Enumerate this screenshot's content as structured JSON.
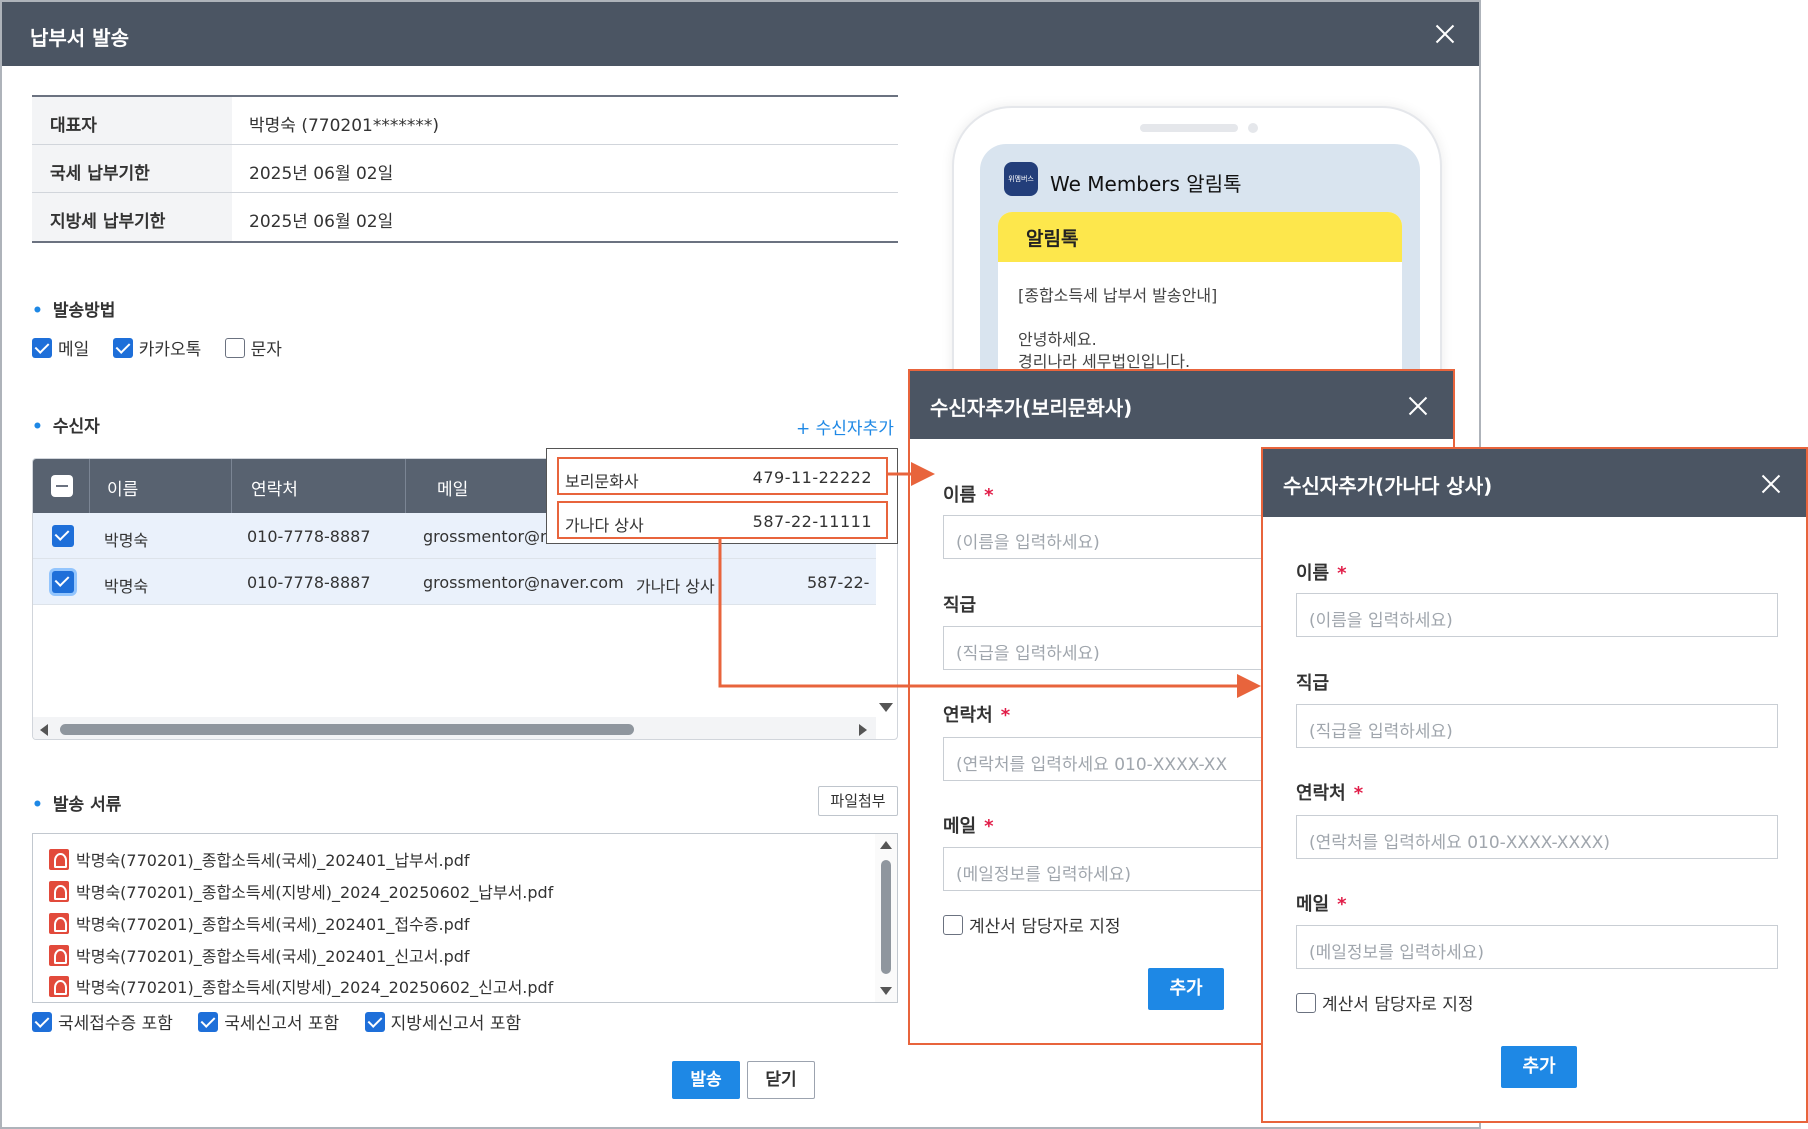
{
  "main": {
    "title": "납부서 발송",
    "info": [
      {
        "label": "대표자",
        "value": "박명숙 (770201*******)"
      },
      {
        "label": "국세 납부기한",
        "value": "2025년 06월 02일"
      },
      {
        "label": "지방세 납부기한",
        "value": "2025년 06월 02일"
      }
    ],
    "method_section": "발송방법",
    "methods": [
      {
        "label": "메일",
        "checked": true
      },
      {
        "label": "카카오톡",
        "checked": true
      },
      {
        "label": "문자",
        "checked": false
      }
    ],
    "recipient_section": "수신자",
    "add_recipient_link": "+ 수신자추가",
    "grid": {
      "headers": [
        "이름",
        "연락처",
        "메일"
      ],
      "rows": [
        {
          "name": "박명숙",
          "phone": "010-7778-8887",
          "email": "grossmentor@n"
        },
        {
          "name": "박명숙",
          "phone": "010-7778-8887",
          "email": "grossmentor@naver.com",
          "company": "가나다 상사",
          "bizno": "587-22-"
        }
      ]
    },
    "docs_section": "발송 서류",
    "attach_button": "파일첨부",
    "files": [
      "박명숙(770201)_종합소득세(국세)_202401_납부서.pdf",
      "박명숙(770201)_종합소득세(지방세)_2024_20250602_납부서.pdf",
      "박명숙(770201)_종합소득세(국세)_202401_접수증.pdf",
      "박명숙(770201)_종합소득세(국세)_202401_신고서.pdf",
      "박명숙(770201)_종합소득세(지방세)_2024_20250602_신고서.pdf"
    ],
    "include_options": [
      {
        "label": "국세접수증 포함",
        "checked": true
      },
      {
        "label": "국세신고서 포함",
        "checked": true
      },
      {
        "label": "지방세신고서 포함",
        "checked": true
      }
    ],
    "send_button": "발송",
    "close_button": "닫기"
  },
  "phone": {
    "logo_text": "위멤버스",
    "sender": "We Members 알림톡",
    "card_header": "알림톡",
    "lines": [
      "[종합소득세 납부서 발송안내]",
      "",
      "안녕하세요.",
      "경리나라 세무법인입니다."
    ]
  },
  "dropdown": {
    "options": [
      {
        "name": "보리문화사",
        "bizno": "479-11-22222"
      },
      {
        "name": "가나다 상사",
        "bizno": "587-22-11111"
      }
    ]
  },
  "dialog1": {
    "title": "수신자추가(보리문화사)",
    "fields": [
      {
        "label": "이름",
        "required": true,
        "placeholder": "(이름을 입력하세요)"
      },
      {
        "label": "직급",
        "required": false,
        "placeholder": "(직급을 입력하세요)"
      },
      {
        "label": "연락처",
        "required": true,
        "placeholder": "(연락처를 입력하세요 010-XXXX-XX"
      },
      {
        "label": "메일",
        "required": true,
        "placeholder": "(메일정보를 입력하세요)"
      }
    ],
    "checkbox_label": "계산서 담당자로 지정",
    "add_button": "추가"
  },
  "dialog2": {
    "title": "수신자추가(가나다 상사)",
    "fields": [
      {
        "label": "이름",
        "required": true,
        "placeholder": "(이름을 입력하세요)"
      },
      {
        "label": "직급",
        "required": false,
        "placeholder": "(직급을 입력하세요)"
      },
      {
        "label": "연락처",
        "required": true,
        "placeholder": "(연락처를 입력하세요 010-XXXX-XXXX)"
      },
      {
        "label": "메일",
        "required": true,
        "placeholder": "(메일정보를 입력하세요)"
      }
    ],
    "checkbox_label": "계산서 담당자로 지정",
    "add_button": "추가"
  },
  "colors": {
    "titlebar": "#4b5563",
    "accent_blue": "#1e88e5",
    "highlight_orange": "#e8643c",
    "kakao_yellow": "#fde74c"
  }
}
